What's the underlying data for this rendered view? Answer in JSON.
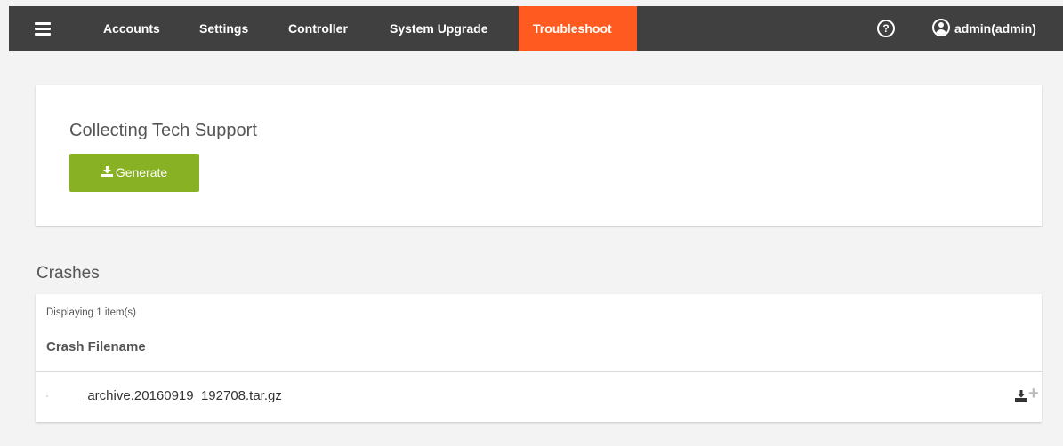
{
  "nav": {
    "items": [
      {
        "label": "Accounts"
      },
      {
        "label": "Settings"
      },
      {
        "label": "Controller"
      },
      {
        "label": "System Upgrade"
      },
      {
        "label": "Troubleshoot",
        "active": true
      }
    ],
    "help_label": "?",
    "user_label": "admin(admin)"
  },
  "tech_support": {
    "title": "Collecting Tech Support",
    "generate_label": "Generate"
  },
  "crashes": {
    "section_title": "Crashes",
    "count_text": "Displaying 1 item(s)",
    "column_header": "Crash Filename",
    "rows": [
      {
        "filename": "_archive.20160919_192708.tar.gz"
      }
    ]
  },
  "colors": {
    "topbar": "#404040",
    "active_tab": "#ff5a1f",
    "generate_button": "#89b124",
    "background": "#f3f3f3"
  },
  "icons": [
    "hamburger-icon",
    "help-icon",
    "user-icon",
    "download-icon",
    "plus-icon"
  ]
}
